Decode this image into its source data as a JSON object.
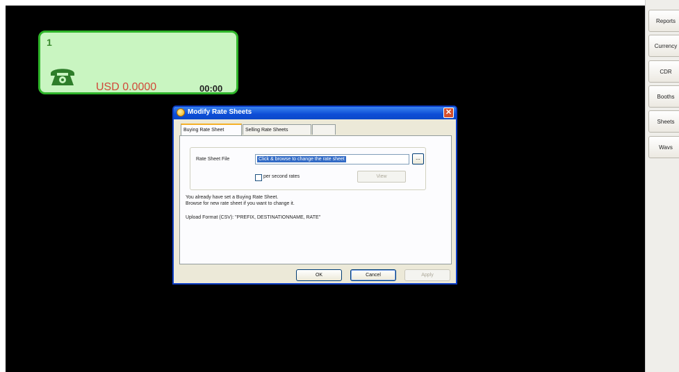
{
  "booth": {
    "number": "1",
    "amount": "USD 0.0000",
    "time": "00:00",
    "icon": "phone-icon",
    "bg_color": "#c9f5c1",
    "border_color": "#2fb52a"
  },
  "sidebar": {
    "items": [
      {
        "label": "Reports"
      },
      {
        "label": "Currency"
      },
      {
        "label": "CDR"
      },
      {
        "label": "Booths"
      },
      {
        "label": "Sheets"
      },
      {
        "label": "Wavs"
      }
    ]
  },
  "dialog": {
    "title": "Modify Rate Sheets",
    "close_glyph": "✕",
    "tabs": [
      {
        "label": "Buying Rate Sheet",
        "active": true
      },
      {
        "label": "Selling Rate Sheets",
        "active": false
      },
      {
        "label": "",
        "active": false
      }
    ],
    "rate_sheet_label": "Rate Sheet File",
    "file_value": "Click & browse to change the rate sheet",
    "browse_label": "...",
    "per_second_label": "per second rates",
    "view_label": "View",
    "info_line1": "You already have set a Buying Rate Sheet.",
    "info_line2": "Browse for new rate sheet if you want to change it.",
    "format_text": "Upload Format (CSV): \"PREFIX, DESTINATIONNAME, RATE\"",
    "ok_label": "OK",
    "cancel_label": "Cancel",
    "apply_label": "Apply"
  }
}
